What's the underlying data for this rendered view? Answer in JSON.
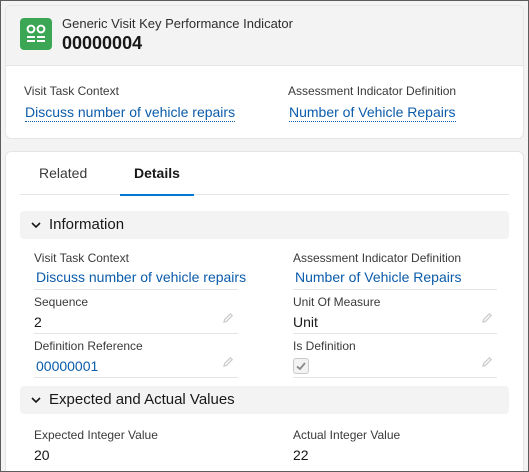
{
  "header": {
    "object_label": "Generic Visit Key Performance Indicator",
    "record_name": "00000004",
    "icon": "kpi-record-icon",
    "highlights": [
      {
        "label": "Visit Task Context",
        "value": "Discuss number of vehicle repairs"
      },
      {
        "label": "Assessment Indicator Definition",
        "value": "Number of Vehicle Repairs"
      }
    ]
  },
  "tabs": [
    {
      "label": "Related",
      "active": false
    },
    {
      "label": "Details",
      "active": true
    }
  ],
  "sections": {
    "information": {
      "title": "Information",
      "fields": {
        "visit_task_context": {
          "label": "Visit Task Context",
          "value": "Discuss number of vehicle repairs"
        },
        "assessment_indicator_definition": {
          "label": "Assessment Indicator Definition",
          "value": "Number of Vehicle Repairs"
        },
        "sequence": {
          "label": "Sequence",
          "value": "2"
        },
        "unit_of_measure": {
          "label": "Unit Of Measure",
          "value": "Unit"
        },
        "definition_reference": {
          "label": "Definition Reference",
          "value": "00000001"
        },
        "is_definition": {
          "label": "Is Definition",
          "checked": true
        }
      }
    },
    "expected_actual": {
      "title": "Expected and Actual Values",
      "fields": {
        "expected_integer_value": {
          "label": "Expected Integer Value",
          "value": "20"
        },
        "actual_integer_value": {
          "label": "Actual Integer Value",
          "value": "22"
        }
      }
    }
  },
  "colors": {
    "accent": "#0176d3",
    "link": "#0b5cab",
    "icon_bg": "#3ba755"
  }
}
